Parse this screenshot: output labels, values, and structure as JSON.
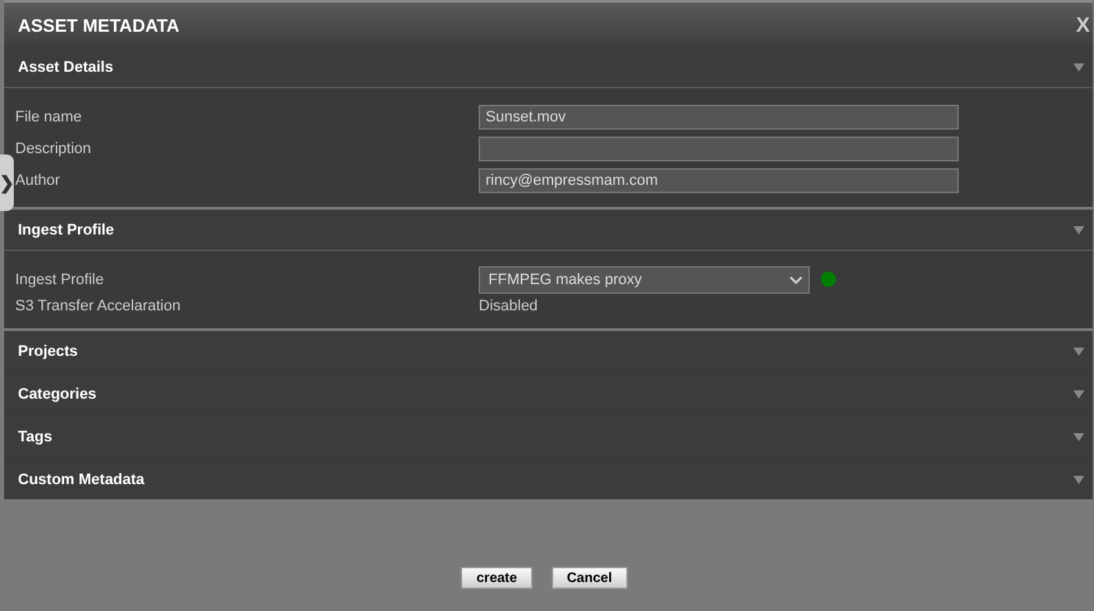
{
  "window": {
    "title": "ASSET METADATA",
    "close": "X"
  },
  "side_handle": "❯",
  "sections": [
    {
      "title": "Asset Details",
      "expanded": true,
      "rows": [
        {
          "kind": "input",
          "label": "File name",
          "value": "Sunset.mov"
        },
        {
          "kind": "input",
          "label": "Description"
        },
        {
          "kind": "input",
          "label": "Author",
          "value": "rincy@empressmam.com"
        }
      ]
    },
    {
      "title": "Ingest Profile",
      "expanded": true,
      "rows": [
        {
          "kind": "select",
          "label": "Ingest Profile",
          "value": "FFMPEG makes proxy",
          "color": "#008000"
        },
        {
          "kind": "text",
          "label": "S3 Transfer Accelaration",
          "value": "Disabled"
        }
      ]
    },
    {
      "title": "Projects",
      "expanded": false
    },
    {
      "title": "Categories",
      "expanded": false
    },
    {
      "title": "Tags",
      "expanded": false
    },
    {
      "title": "Custom Metadata",
      "expanded": false
    }
  ],
  "buttons": [
    "create",
    "Cancel"
  ]
}
